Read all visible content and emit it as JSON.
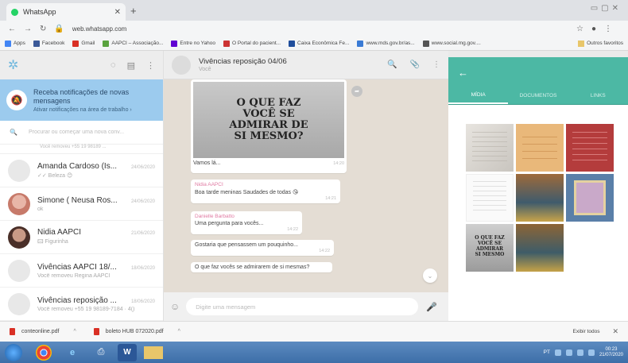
{
  "browser": {
    "tab_title": "WhatsApp",
    "new_tab": "+",
    "url": "web.whatsapp.com",
    "bookmarks": [
      {
        "label": "Apps",
        "color": "#4285f4"
      },
      {
        "label": "Facebook",
        "color": "#3b5998"
      },
      {
        "label": "Gmail",
        "color": "#d93025"
      },
      {
        "label": "AAPCI – Associação...",
        "color": "#5aa33f"
      },
      {
        "label": "Entre no Yahoo",
        "color": "#6001d2"
      },
      {
        "label": "O Portal do pacient...",
        "color": "#cc3333"
      },
      {
        "label": "Caixa Econômica Fe...",
        "color": "#1f4e9c"
      },
      {
        "label": "www.mds.gov.br/as...",
        "color": "#3a7bd5"
      },
      {
        "label": "www.social.mg.gov....",
        "color": "#555555"
      }
    ],
    "other_bookmarks": "Outros favoritos"
  },
  "sidebar": {
    "notification": {
      "title": "Receba notificações de novas mensagens",
      "subtitle": "Ativar notificações na área de trabalho ›"
    },
    "search_placeholder": "Procurar ou começar uma nova conv...",
    "trail_text": "Você removeu +55 19 98189 ...",
    "chats": [
      {
        "name": "Amanda Cardoso (Is...",
        "time": "24/06/2020",
        "preview": "✓✓ Beleza 😊",
        "avatar": "blank"
      },
      {
        "name": "Simone ( Neusa Ros...",
        "time": "24/06/2020",
        "preview": "ok",
        "avatar": "pink"
      },
      {
        "name": "Nidia AAPCI",
        "time": "21/06/2020",
        "preview": "🖾 Figurinha",
        "avatar": "dark"
      },
      {
        "name": "Vivências AAPCI 18/...",
        "time": "18/06/2020",
        "preview": "Você removeu Regina AAPCI",
        "avatar": "blank"
      },
      {
        "name": "Vivências reposição ...",
        "time": "18/06/2020",
        "preview": "Você removeu +55 19 98189-7184 ·  4()",
        "avatar": "blank"
      }
    ]
  },
  "conversation": {
    "title": "Vivências reposição 04/06",
    "subtitle": "Você",
    "image_text": [
      "O QUE FAZ",
      "VOCÊ SE",
      "ADMIRAR DE",
      "SI MESMO?"
    ],
    "image_caption": "Vamos lá...",
    "image_time": "14:20",
    "messages": [
      {
        "author": "Nidia AAPCI",
        "text": "Boa tarde meninas Saudades de todas 😘",
        "time": "14:21"
      },
      {
        "author": "Danielle Barbatto",
        "text": "Uma pergunta para vocês...",
        "time": "14:22"
      },
      {
        "author": "",
        "text": "Gostaria que pensassem um pouquinho...",
        "time": "14:22"
      },
      {
        "author": "",
        "text": "O que faz vocês se admirarem de si mesmas?",
        "time": ""
      }
    ],
    "composer_placeholder": "Digite uma mensagem"
  },
  "media_panel": {
    "tabs": [
      "MÍDIA",
      "DOCUMENTOS",
      "LINKS"
    ],
    "active_tab": "MÍDIA",
    "thumb7_text": [
      "O QUE FAZ",
      "VOCÊ SE",
      "ADMIRAR",
      "SI MESMO"
    ]
  },
  "downloads": {
    "files": [
      "conteonline.pdf",
      "boleto HUB 072020.pdf"
    ],
    "show_all": "Exibir todos"
  },
  "taskbar": {
    "lang": "PT",
    "time": "00:23",
    "date": "21/07/2020"
  }
}
